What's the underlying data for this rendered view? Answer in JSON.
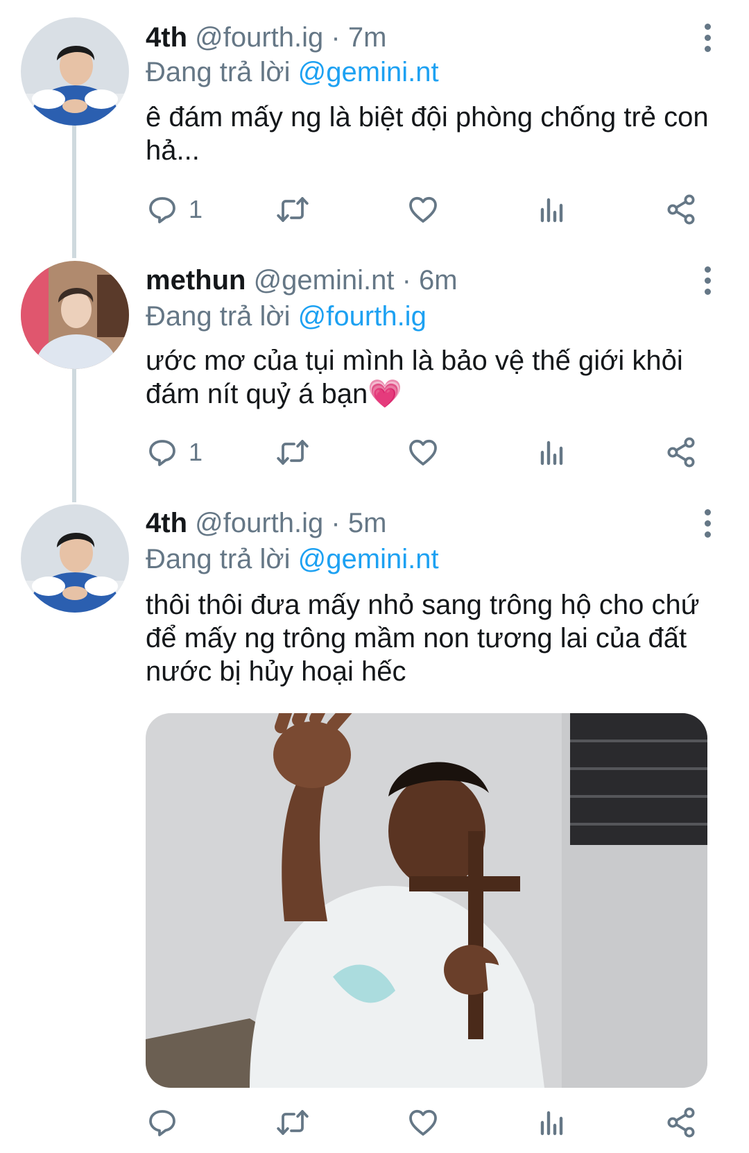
{
  "tweets": [
    {
      "name": "4th",
      "handle": "@fourth.ig",
      "time": "· 7m",
      "reply_prefix": "Đang trả lời",
      "reply_to": "@gemini.nt",
      "text": "ê đám mấy ng là biệt đội phòng chống trẻ con hả...",
      "reply_count": "1"
    },
    {
      "name": "methun",
      "handle": "@gemini.nt",
      "time": "· 6m",
      "reply_prefix": "Đang trả lời",
      "reply_to": "@fourth.ig",
      "text": "ước mơ của tụi mình là bảo vệ thế giới khỏi đám nít quỷ á bạn💗",
      "reply_count": "1"
    },
    {
      "name": "4th",
      "handle": "@fourth.ig",
      "time": "· 5m",
      "reply_prefix": "Đang trả lời",
      "reply_to": "@gemini.nt",
      "text": "thôi thôi đưa mấy nhỏ sang trông hộ cho chứ để mấy ng trông mầm non tương lai của đất nước bị hủy hoại hếc",
      "reply_count": ""
    }
  ],
  "colors": {
    "text": "#14171a",
    "secondary": "#657786",
    "link": "#1da1f2",
    "thread_line": "#cfd9de"
  },
  "icons": [
    "reply-icon",
    "retweet-icon",
    "like-icon",
    "analytics-icon",
    "share-icon",
    "more-icon"
  ]
}
